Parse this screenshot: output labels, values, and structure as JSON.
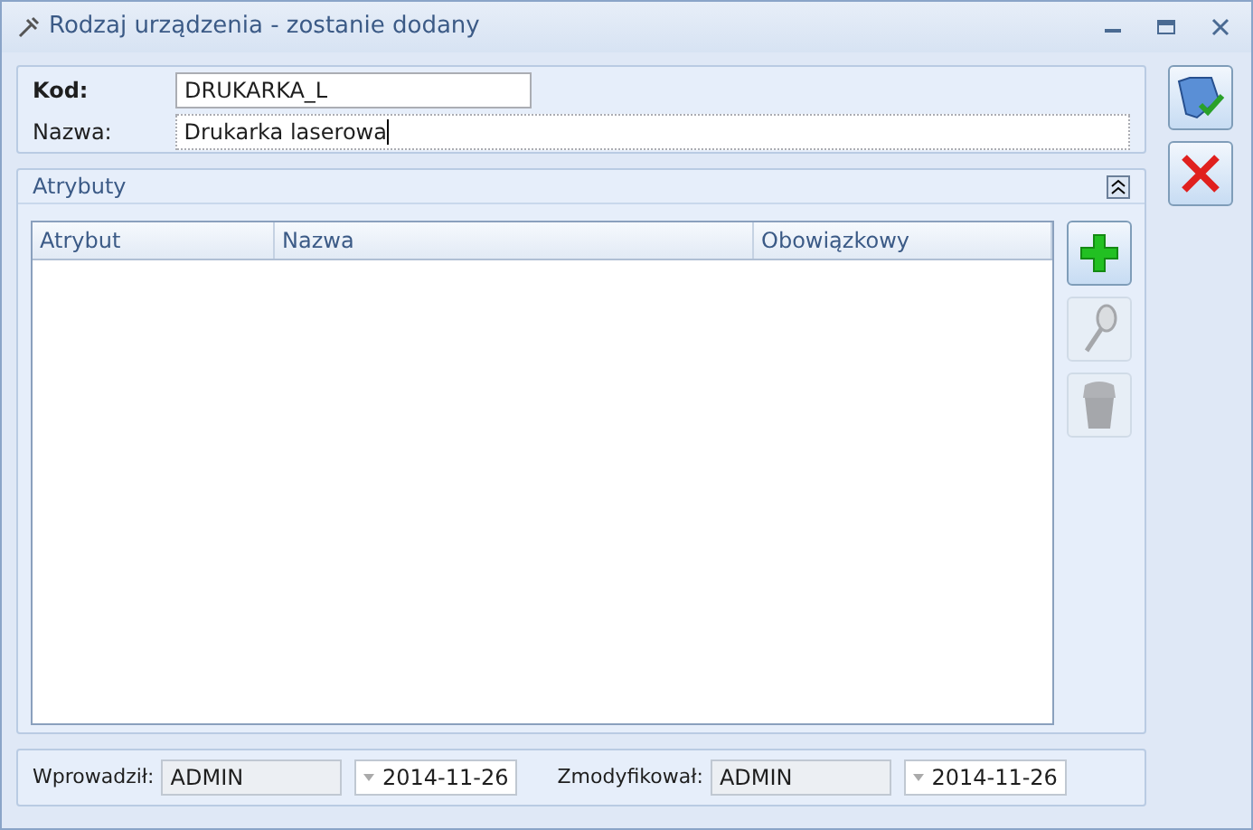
{
  "window": {
    "title": "Rodzaj urządzenia - zostanie dodany"
  },
  "form": {
    "code_label": "Kod:",
    "code_value": "DRUKARKA_L",
    "name_label": "Nazwa:",
    "name_value": "Drukarka laserowa"
  },
  "attributes": {
    "title": "Atrybuty",
    "expanded": true,
    "columns": [
      "Atrybut",
      "Nazwa",
      "Obowiązkowy"
    ],
    "tools": [
      {
        "kind": "add",
        "disabled": false
      },
      {
        "kind": "edit",
        "disabled": true
      },
      {
        "kind": "delete",
        "disabled": true
      }
    ]
  },
  "footer": {
    "created_label": "Wprowadził:",
    "created_by": "ADMIN",
    "created_date": "2014-11-26",
    "modified_label": "Zmodyfikował:",
    "modified_by": "ADMIN",
    "modified_date": "2014-11-26"
  },
  "actions": [
    {
      "kind": "save"
    },
    {
      "kind": "cancel"
    }
  ]
}
